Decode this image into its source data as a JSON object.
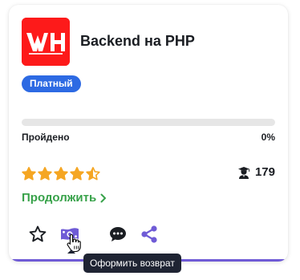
{
  "course": {
    "logo_text": "WH",
    "title": "Backend на PHP",
    "badge": "Платный"
  },
  "progress": {
    "label": "Пройдено",
    "percent_text": "0%",
    "value": 0
  },
  "rating": {
    "value": 4.5,
    "max": 5,
    "color": "#f5a623"
  },
  "students": {
    "count": "179",
    "icon": "student-icon"
  },
  "cta": {
    "continue_label": "Продолжить",
    "color": "#38a24a"
  },
  "actions": [
    {
      "name": "favorite",
      "icon": "star-outline-icon"
    },
    {
      "name": "refund",
      "icon": "money-icon"
    },
    {
      "name": "comments",
      "icon": "comment-icon"
    },
    {
      "name": "share",
      "icon": "share-icon"
    }
  ],
  "tooltip": {
    "text": "Оформить возврат"
  },
  "colors": {
    "accent": "#2d6ae3",
    "purple": "#6f5bd6",
    "logo_bg": "#fd1a1a"
  }
}
